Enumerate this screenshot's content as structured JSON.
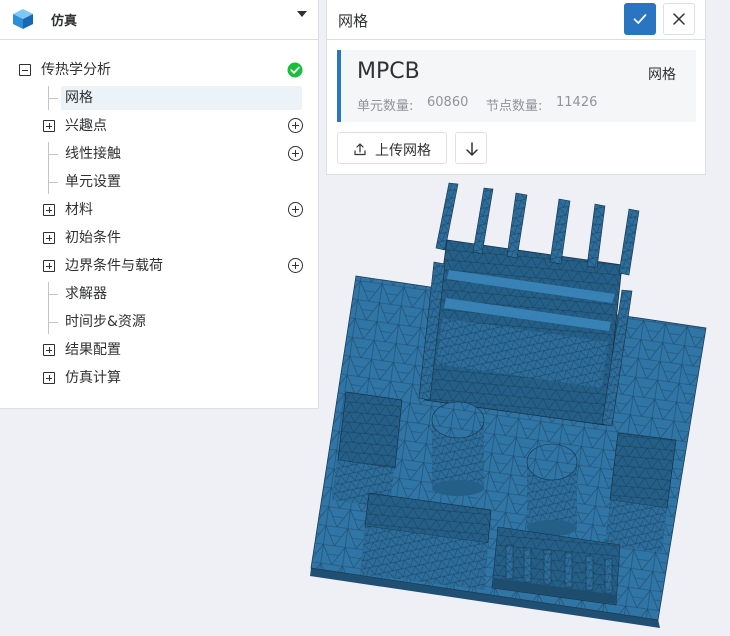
{
  "app": {
    "title": "仿真"
  },
  "tree": {
    "root": {
      "label": "传热学分析",
      "status": "completed"
    },
    "items": [
      {
        "label": "网格",
        "selected": true
      },
      {
        "label": "兴趣点"
      },
      {
        "label": "线性接触"
      },
      {
        "label": "单元设置"
      },
      {
        "label": "材料"
      },
      {
        "label": "初始条件"
      },
      {
        "label": "边界条件与载荷"
      },
      {
        "label": "求解器"
      },
      {
        "label": "时间步&资源"
      },
      {
        "label": "结果配置"
      },
      {
        "label": "仿真计算"
      }
    ]
  },
  "mesh_panel": {
    "title": "网格",
    "confirm_icon": "check-icon",
    "close_icon": "close-icon",
    "mesh": {
      "name": "MPCB",
      "type_label": "网格",
      "elements_label": "单元数量:",
      "elements_value": "60860",
      "nodes_label": "节点数量:",
      "nodes_value": "11426"
    },
    "upload_label": "上传网格",
    "upload_icon": "upload-icon",
    "download_icon": "download-icon"
  },
  "colors": {
    "accent": "#2a75c2",
    "success": "#19be3b",
    "mesh_fill": "#2f75a6",
    "mesh_edges": "#1d3d55",
    "selected_bg": "#ebf3f8"
  }
}
